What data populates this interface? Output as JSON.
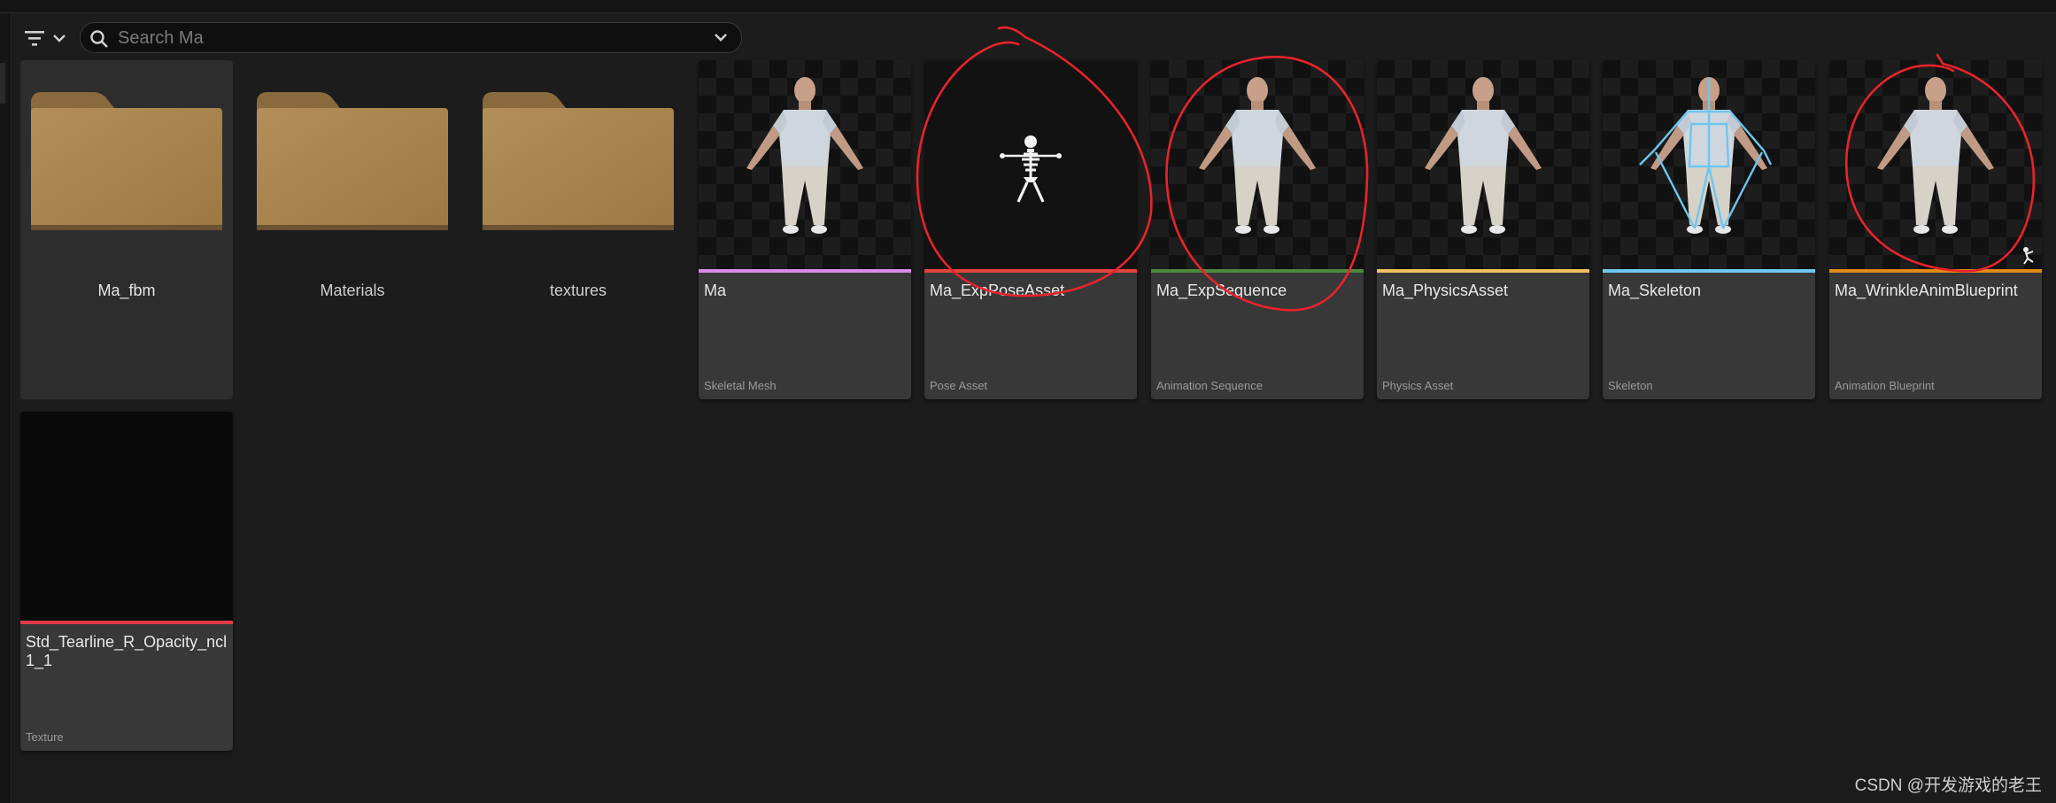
{
  "search": {
    "placeholder": "Search Ma",
    "value": ""
  },
  "folders": [
    {
      "label": "Ma_fbm"
    },
    {
      "label": "Materials"
    },
    {
      "label": "textures"
    }
  ],
  "assets": [
    {
      "name": "Ma",
      "type": "Skeletal Mesh",
      "bar_color": "#d88ae6"
    },
    {
      "name": "Ma_ExpPoseAsset",
      "type": "Pose Asset",
      "bar_color": "#e0443a"
    },
    {
      "name": "Ma_ExpSequence",
      "type": "Animation Sequence",
      "bar_color": "#4c8a3c"
    },
    {
      "name": "Ma_PhysicsAsset",
      "type": "Physics Asset",
      "bar_color": "#f0c060"
    },
    {
      "name": "Ma_Skeleton",
      "type": "Skeleton",
      "bar_color": "#70c8f0"
    },
    {
      "name": "Ma_WrinkleAnimBlueprint",
      "type": "Animation Blueprint",
      "bar_color": "#e08a16"
    },
    {
      "name": "Std_Tearline_R_Opacity_ncl1_1",
      "type": "Texture",
      "bar_color": "#e03a48"
    }
  ],
  "watermark": "CSDN @开发游戏的老王",
  "colors": {
    "background": "#1c1c1c",
    "tile": "#383838",
    "folder": "#a9834f",
    "annotation": "#e8232b"
  },
  "icons": [
    "filter-icon",
    "chevron-down-icon",
    "search-icon",
    "folder-icon",
    "skeleton-icon"
  ]
}
